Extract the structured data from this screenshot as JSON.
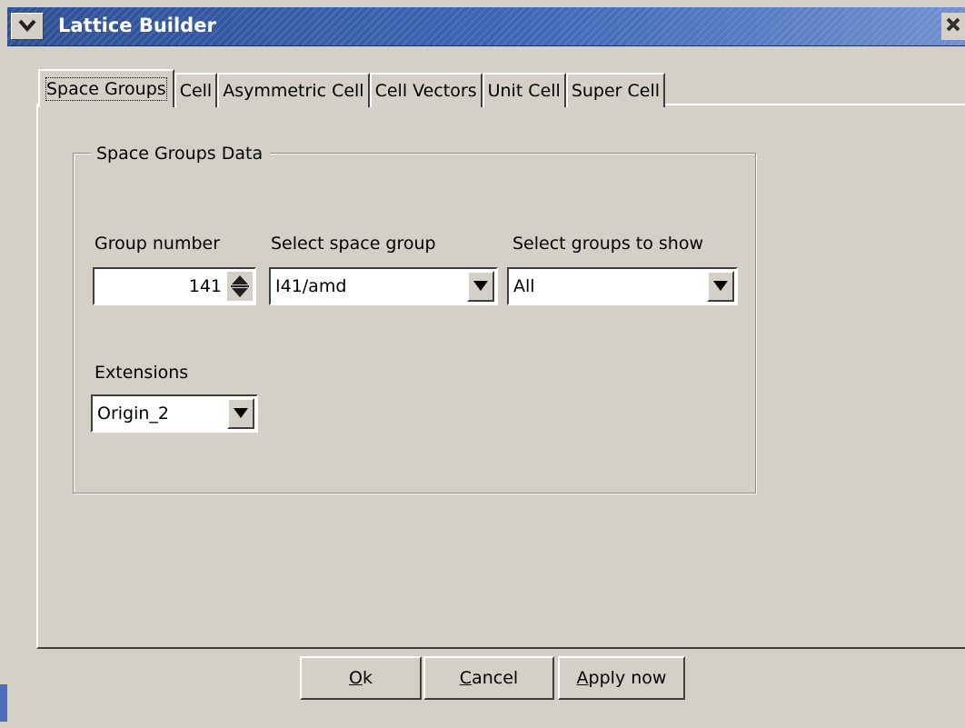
{
  "window": {
    "title": "Lattice Builder"
  },
  "tabs": [
    {
      "label": "Space Groups",
      "active": true
    },
    {
      "label": "Cell",
      "active": false
    },
    {
      "label": "Asymmetric Cell",
      "active": false
    },
    {
      "label": "Cell Vectors",
      "active": false
    },
    {
      "label": "Unit Cell",
      "active": false
    },
    {
      "label": "Super Cell",
      "active": false
    }
  ],
  "frame": {
    "title": "Space Groups Data"
  },
  "group_number": {
    "label": "Group number",
    "value": "141"
  },
  "space_group": {
    "label": "Select space group",
    "value": "I41/amd"
  },
  "groups_to_show": {
    "label": "Select groups to show",
    "value": "All"
  },
  "extensions": {
    "label": "Extensions",
    "value": "Origin_2"
  },
  "buttons": {
    "ok": {
      "mnemonic": "O",
      "rest": "k"
    },
    "cancel": {
      "mnemonic": "C",
      "rest": "ancel"
    },
    "apply": {
      "mnemonic": "A",
      "rest": "pply now"
    }
  }
}
